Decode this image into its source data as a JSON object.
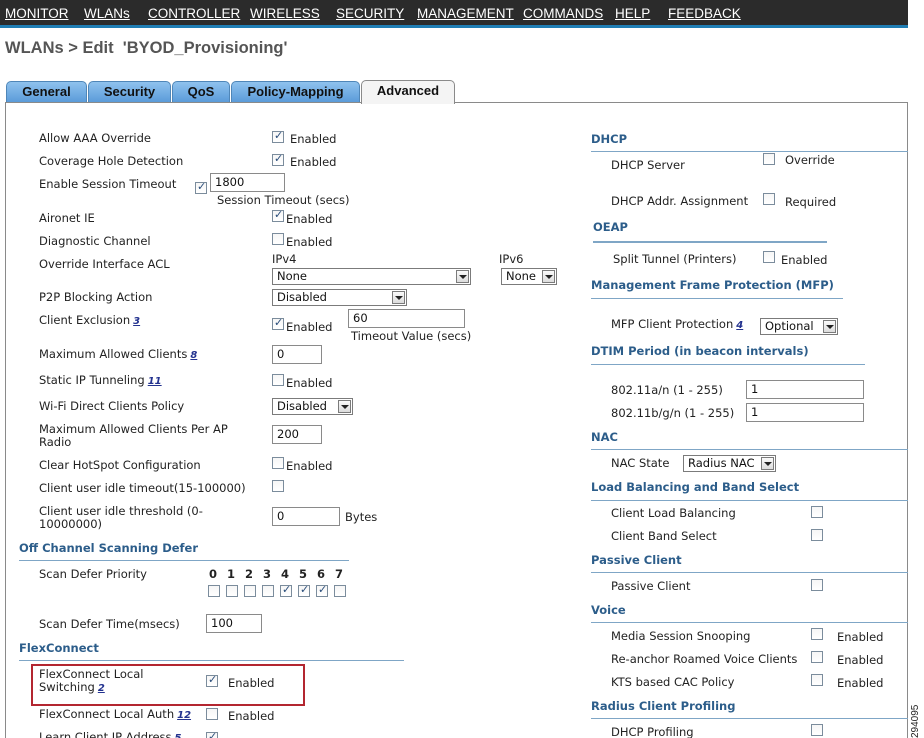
{
  "menu": [
    "MONITOR",
    "WLANs",
    "CONTROLLER",
    "WIRELESS",
    "SECURITY",
    "MANAGEMENT",
    "COMMANDS",
    "HELP",
    "FEEDBACK"
  ],
  "page_title": "WLANs > Edit  'BYOD_Provisioning'",
  "tabs": [
    "General",
    "Security",
    "QoS",
    "Policy-Mapping",
    "Advanced"
  ],
  "active_tab": "Advanced",
  "left": {
    "allow_aaa": {
      "label": "Allow AAA Override",
      "checked": true,
      "text": "Enabled"
    },
    "coverage": {
      "label": "Coverage Hole Detection",
      "checked": true,
      "text": "Enabled"
    },
    "session_timeout": {
      "label": "Enable Session Timeout",
      "checked": true,
      "value": "1800",
      "caption": "Session Timeout (secs)"
    },
    "aironet": {
      "label": "Aironet IE",
      "checked": true,
      "text": "Enabled"
    },
    "diag": {
      "label": "Diagnostic Channel",
      "checked": false,
      "text": "Enabled"
    },
    "acl": {
      "label": "Override Interface ACL",
      "ipv4_label": "IPv4",
      "ipv4_value": "None",
      "ipv6_label": "IPv6",
      "ipv6_value": "None"
    },
    "p2p": {
      "label": "P2P Blocking Action",
      "value": "Disabled"
    },
    "client_exclusion": {
      "label": "Client Exclusion",
      "link": "3",
      "checked": true,
      "text": "Enabled",
      "value": "60",
      "caption": "Timeout Value (secs)"
    },
    "max_clients": {
      "label": "Maximum Allowed Clients",
      "link": "8",
      "value": "0"
    },
    "static_ip": {
      "label": "Static IP Tunneling",
      "link": "11",
      "checked": false,
      "text": "Enabled"
    },
    "wifi_direct": {
      "label": "Wi-Fi Direct Clients Policy",
      "value": "Disabled"
    },
    "max_per_ap": {
      "label1": "Maximum Allowed Clients Per AP",
      "label2": "Radio",
      "value": "200"
    },
    "hotspot": {
      "label": "Clear HotSpot Configuration",
      "checked": false,
      "text": "Enabled"
    },
    "idle_timeout": {
      "label": "Client user idle timeout(15-100000)",
      "checked": false
    },
    "idle_threshold": {
      "label1": "Client user idle threshold (0-",
      "label2": "10000000)",
      "value": "0",
      "unit": "Bytes"
    }
  },
  "off_channel": {
    "title": "Off Channel Scanning Defer",
    "priority_label": "Scan Defer Priority",
    "digits": [
      "0",
      "1",
      "2",
      "3",
      "4",
      "5",
      "6",
      "7"
    ],
    "checked": [
      false,
      false,
      false,
      false,
      true,
      true,
      true,
      false
    ],
    "time_label": "Scan Defer Time(msecs)",
    "time_value": "100"
  },
  "flexconnect": {
    "title": "FlexConnect",
    "local_switching": {
      "label1": "FlexConnect Local",
      "label2": "Switching",
      "link": "2",
      "checked": true,
      "text": "Enabled"
    },
    "local_auth": {
      "label": "FlexConnect Local Auth",
      "link": "12",
      "checked": false,
      "text": "Enabled"
    },
    "learn_ip": {
      "label": "Learn Client IP Address",
      "link": "5"
    }
  },
  "right": {
    "dhcp": {
      "title": "DHCP",
      "server_label": "DHCP Server",
      "server_text": "Override",
      "server_checked": false,
      "assign_label": "DHCP Addr. Assignment",
      "assign_text": "Required",
      "assign_checked": false
    },
    "oeap": {
      "title": "OEAP",
      "split_label": "Split Tunnel (Printers)",
      "split_text": "Enabled",
      "split_checked": false
    },
    "mfp": {
      "title": "Management Frame Protection (MFP)",
      "label": "MFP Client Protection",
      "link": "4",
      "value": "Optional"
    },
    "dtim": {
      "title": "DTIM Period (in beacon intervals)",
      "a_label": "802.11a/n (1 - 255)",
      "a_value": "1",
      "b_label": "802.11b/g/n (1 - 255)",
      "b_value": "1"
    },
    "nac": {
      "title": "NAC",
      "label": "NAC State",
      "value": "Radius NAC"
    },
    "load_balancing": {
      "title": "Load Balancing and Band Select",
      "lb_label": "Client Load Balancing",
      "bs_label": "Client Band Select"
    },
    "passive": {
      "title": "Passive Client",
      "label": "Passive Client"
    },
    "voice": {
      "title": "Voice",
      "snooping": "Media Session Snooping",
      "reanchor": "Re-anchor Roamed Voice Clients",
      "kts": "KTS based CAC Policy",
      "text": "Enabled"
    },
    "radius": {
      "title": "Radius Client Profiling",
      "dhcp_label": "DHCP Profiling"
    }
  },
  "watermark": "294095"
}
